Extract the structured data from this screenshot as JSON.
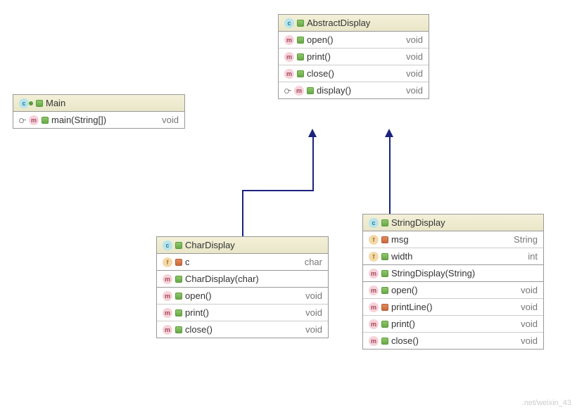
{
  "classes": {
    "main": {
      "name": "Main",
      "methods": [
        {
          "name": "main(String[])",
          "type": "void",
          "vis": "pub",
          "key": true
        }
      ]
    },
    "abstractDisplay": {
      "name": "AbstractDisplay",
      "methods": [
        {
          "name": "open()",
          "type": "void",
          "vis": "pub"
        },
        {
          "name": "print()",
          "type": "void",
          "vis": "pub"
        },
        {
          "name": "close()",
          "type": "void",
          "vis": "pub"
        },
        {
          "name": "display()",
          "type": "void",
          "vis": "pub",
          "key": true
        }
      ]
    },
    "charDisplay": {
      "name": "CharDisplay",
      "fields": [
        {
          "name": "c",
          "type": "char",
          "vis": "priv"
        }
      ],
      "ctors": [
        {
          "name": "CharDisplay(char)",
          "vis": "pub"
        }
      ],
      "methods": [
        {
          "name": "open()",
          "type": "void",
          "vis": "pub"
        },
        {
          "name": "print()",
          "type": "void",
          "vis": "pub"
        },
        {
          "name": "close()",
          "type": "void",
          "vis": "pub"
        }
      ]
    },
    "stringDisplay": {
      "name": "StringDisplay",
      "fields": [
        {
          "name": "msg",
          "type": "String",
          "vis": "priv"
        },
        {
          "name": "width",
          "type": "int",
          "vis": "pub"
        }
      ],
      "ctors": [
        {
          "name": "StringDisplay(String)",
          "vis": "pub"
        }
      ],
      "methods": [
        {
          "name": "open()",
          "type": "void",
          "vis": "pub"
        },
        {
          "name": "printLine()",
          "type": "void",
          "vis": "priv"
        },
        {
          "name": "print()",
          "type": "void",
          "vis": "pub"
        },
        {
          "name": "close()",
          "type": "void",
          "vis": "pub"
        }
      ]
    }
  },
  "watermark": ".net/weixin_43"
}
